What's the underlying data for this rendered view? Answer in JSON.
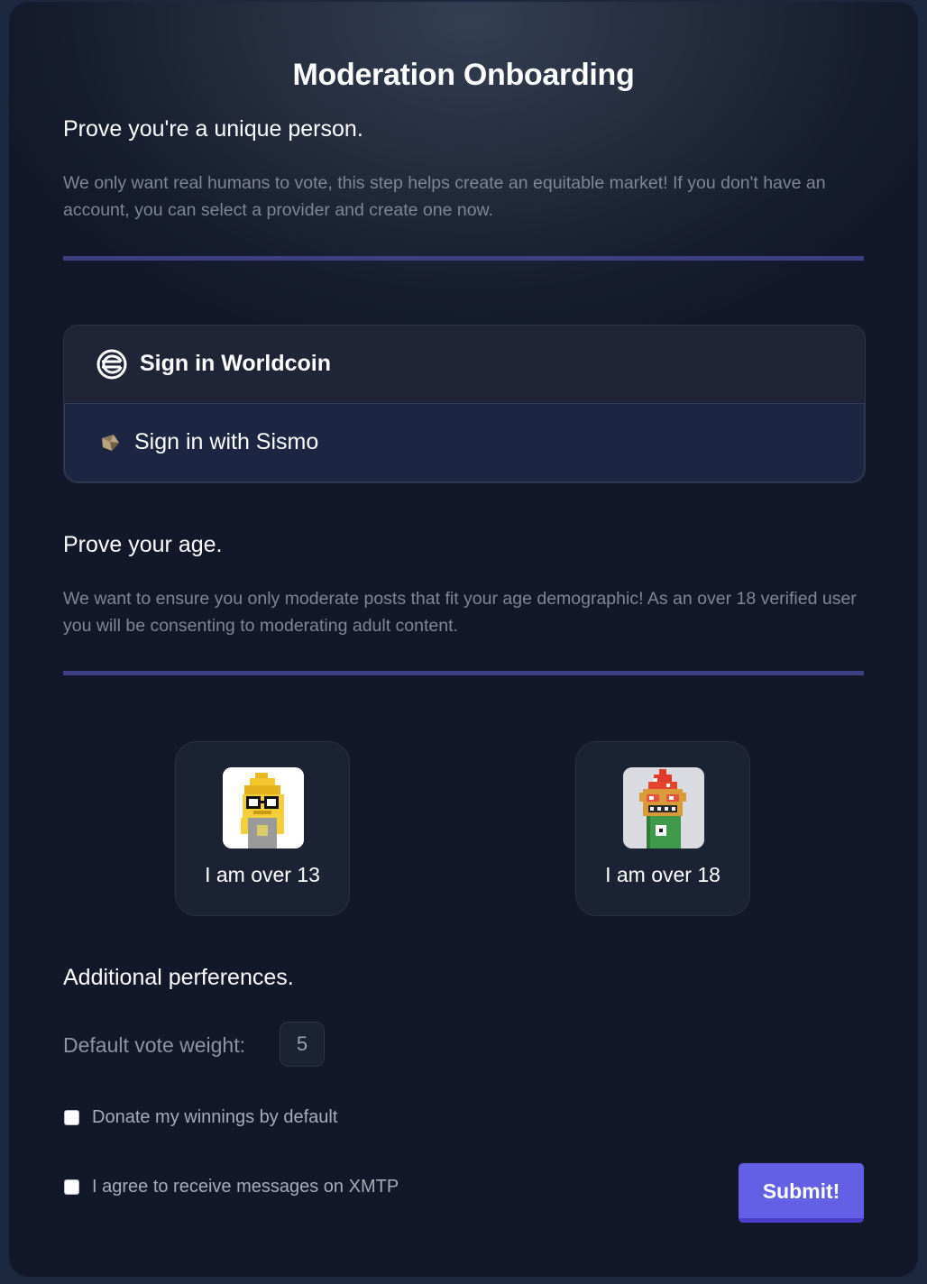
{
  "page": {
    "title": "Moderation Onboarding"
  },
  "unique_person": {
    "heading": "Prove you're a unique person.",
    "description": "We only want real humans to vote, this step helps create an equitable market! If you don't have an account, you can select a provider and create one now.",
    "providers": [
      {
        "label": "Sign in Worldcoin",
        "icon": "worldcoin-icon"
      },
      {
        "label": "Sign in with Sismo",
        "icon": "sismo-icon"
      }
    ]
  },
  "age": {
    "heading": "Prove your age.",
    "description": "We want to ensure you only moderate posts that fit your age demographic! As an over 18 verified user you will be consenting to moderating adult content.",
    "options": [
      {
        "label": "I am over 13",
        "avatar": "pixel-avatar-gold-crown"
      },
      {
        "label": "I am over 18",
        "avatar": "pixel-avatar-green-party-hat"
      }
    ]
  },
  "preferences": {
    "heading": "Additional perferences.",
    "vote_weight_label": "Default vote weight:",
    "vote_weight_value": "5",
    "donate_label": "Donate my winnings by default",
    "xmtp_label": "I agree to receive messages on XMTP",
    "submit_label": "Submit!"
  },
  "colors": {
    "accent": "#6360e6",
    "divider": "#3d3f82",
    "panel_bg": "#121829"
  }
}
